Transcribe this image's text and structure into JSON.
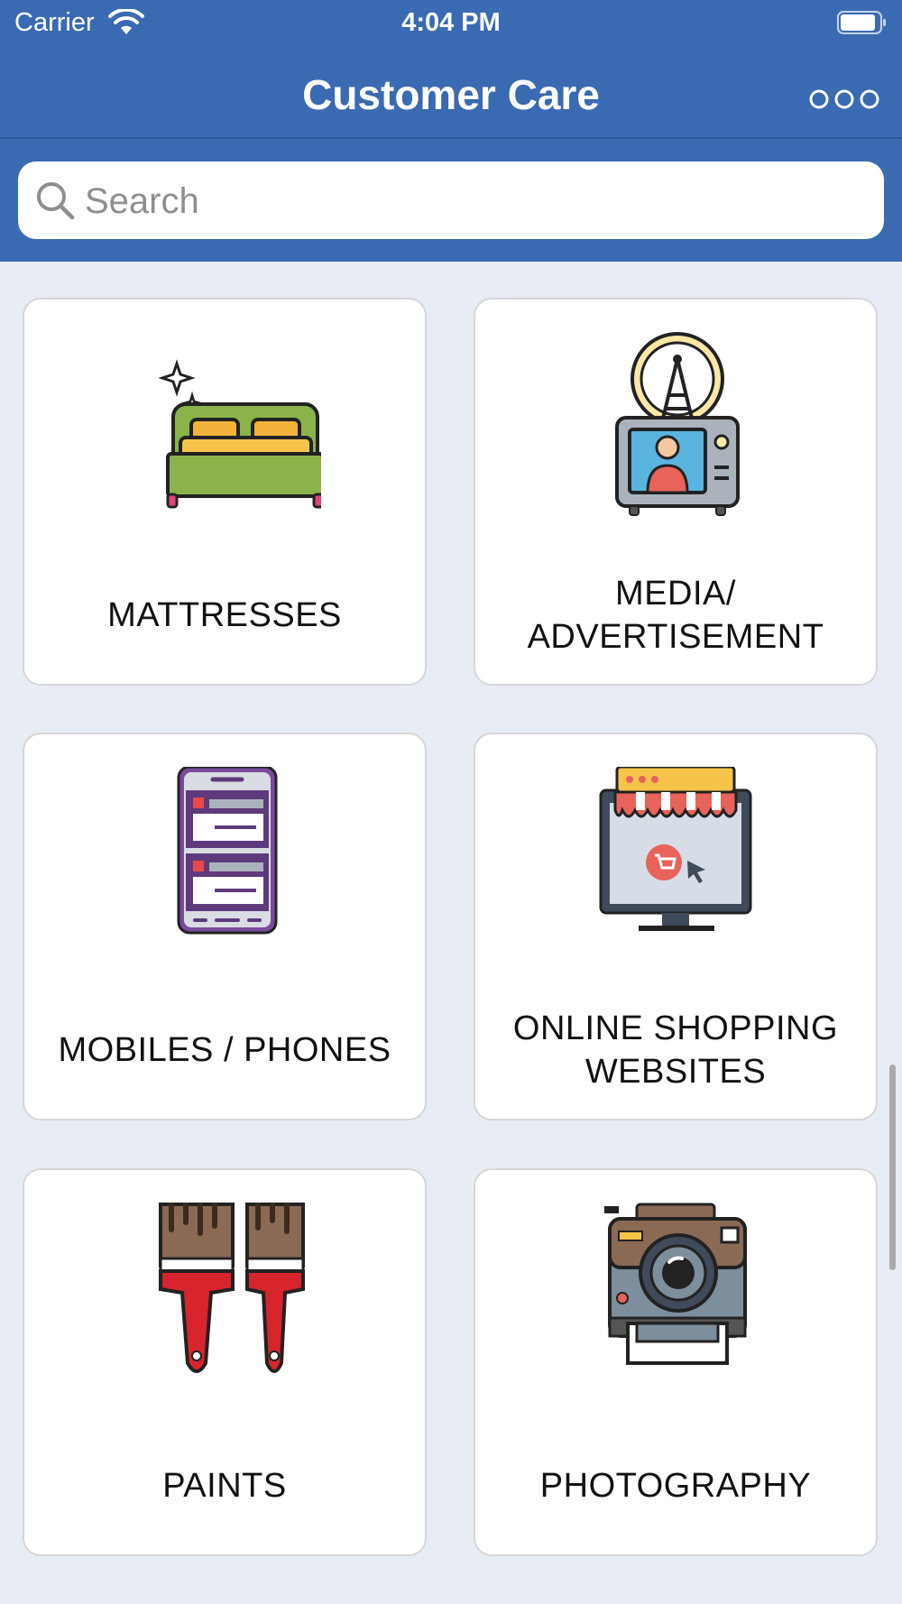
{
  "status_bar": {
    "carrier": "Carrier",
    "time": "4:04 PM"
  },
  "nav": {
    "title": "Customer Care"
  },
  "search": {
    "placeholder": "Search",
    "value": ""
  },
  "categories": [
    {
      "label": "MATTRESSES",
      "icon": "bed-icon"
    },
    {
      "label": "MEDIA/ ADVERTISEMENT",
      "icon": "tv-antenna-icon"
    },
    {
      "label": "MOBILES / PHONES",
      "icon": "mobile-phone-icon"
    },
    {
      "label": "ONLINE SHOPPING WEBSITES",
      "icon": "online-store-icon"
    },
    {
      "label": "PAINTS",
      "icon": "paint-brushes-icon"
    },
    {
      "label": "PHOTOGRAPHY",
      "icon": "camera-icon"
    }
  ],
  "colors": {
    "header_bg": "#3a6ab1",
    "page_bg": "#e8ecf5",
    "tile_bg": "#ffffff"
  }
}
